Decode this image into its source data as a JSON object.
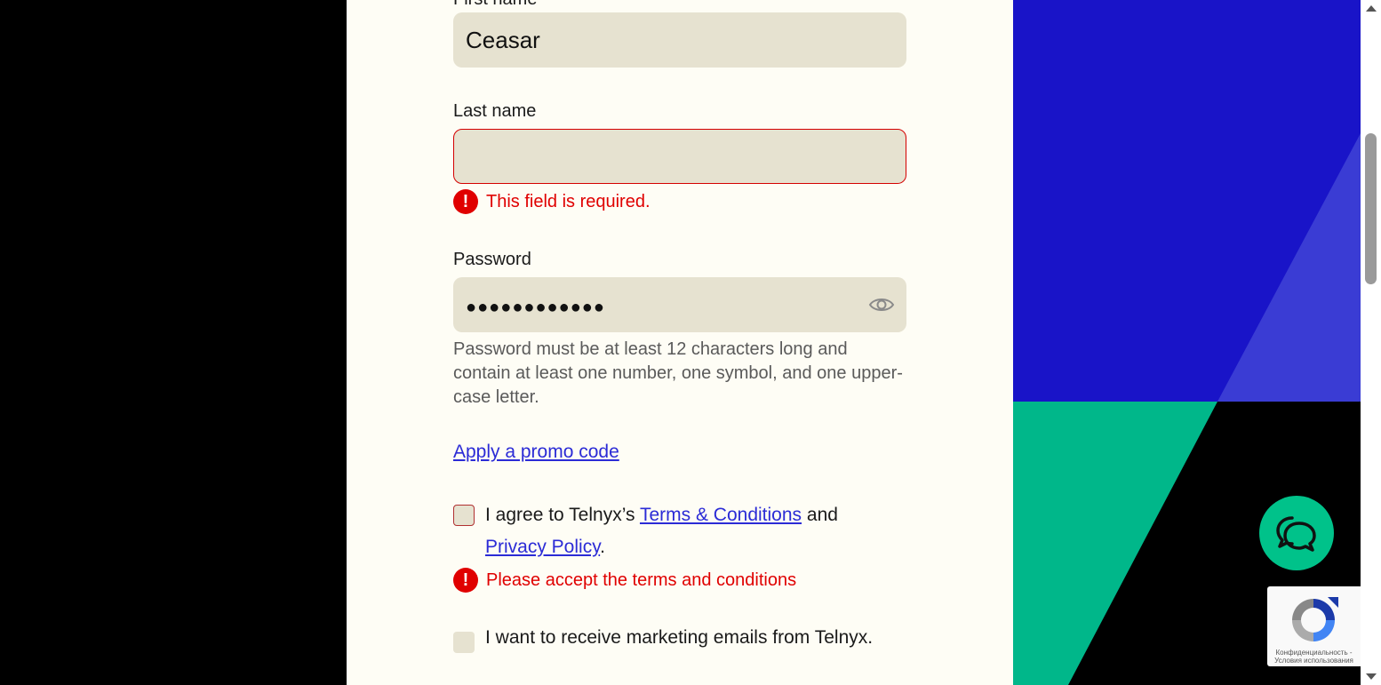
{
  "form": {
    "first_name": {
      "label": "First name",
      "value": "Ceasar"
    },
    "last_name": {
      "label": "Last name",
      "value": "",
      "error": "This field is required."
    },
    "password": {
      "label": "Password",
      "masked_value": "●●●●●●●●●●●●",
      "hint": "Password must be at least 12 characters long and contain at least one number, one symbol, and one upper-case letter."
    },
    "promo_link": "Apply a promo code",
    "terms": {
      "prefix": "I agree to Telnyx’s",
      "terms_link": "Terms & Conditions",
      "and": "and",
      "privacy_link": "Privacy Policy",
      "suffix": ".",
      "error": "Please accept the terms and conditions",
      "checked": false
    },
    "marketing": {
      "label": "I want to receive marketing emails from Telnyx.",
      "checked": false
    }
  },
  "recaptcha": {
    "text": "Конфиденциальность - Условия использования"
  },
  "icons": {
    "error": "exclamation-circle-icon",
    "eye": "eye-icon",
    "chat": "chat-bubbles-icon",
    "recaptcha": "recaptcha-logo-icon"
  },
  "colors": {
    "panel_bg": "#fefdf5",
    "field_bg": "#e6e2d0",
    "error": "#e00000",
    "link": "#2b2bd6",
    "art_blue": "#1914c8",
    "art_green": "#00b78a",
    "chat_green": "#00c28a"
  }
}
